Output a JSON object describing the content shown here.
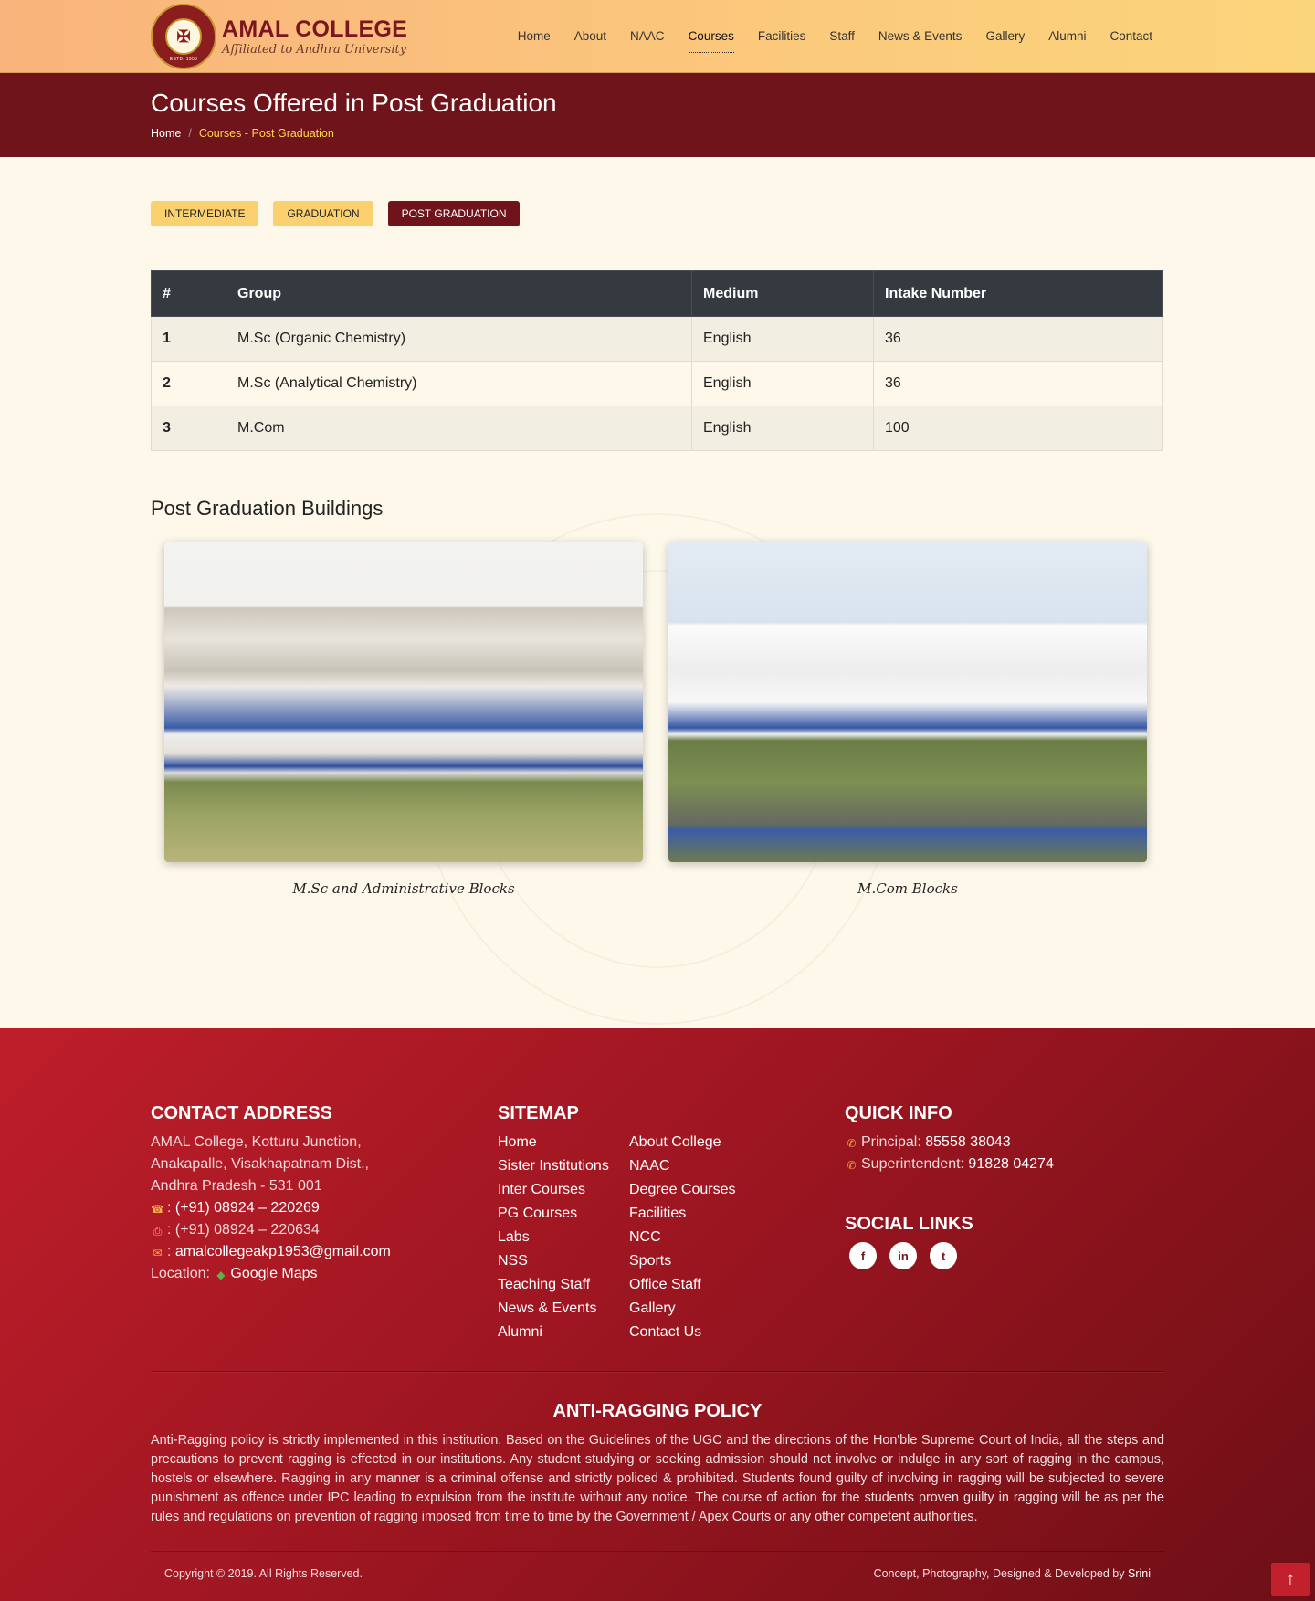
{
  "header": {
    "college_name": "AMAL COLLEGE",
    "affiliation": "Affiliated to Andhra University",
    "logo_estd": "ESTD. 1953",
    "nav": [
      {
        "label": "Home"
      },
      {
        "label": "About"
      },
      {
        "label": "NAAC"
      },
      {
        "label": "Courses",
        "active": true
      },
      {
        "label": "Facilities"
      },
      {
        "label": "Staff"
      },
      {
        "label": "News & Events"
      },
      {
        "label": "Gallery"
      },
      {
        "label": "Alumni"
      },
      {
        "label": "Contact"
      }
    ]
  },
  "title_bar": {
    "title": "Courses Offered in Post Graduation",
    "breadcrumb_home": "Home",
    "breadcrumb_separator": "/",
    "breadcrumb_current": "Courses - Post Graduation"
  },
  "tabs": [
    {
      "label": "INTERMEDIATE"
    },
    {
      "label": "GRADUATION"
    },
    {
      "label": "POST GRADUATION",
      "active": true
    }
  ],
  "courses_table": {
    "headers": [
      "#",
      "Group",
      "Medium",
      "Intake Number"
    ],
    "rows": [
      [
        "1",
        "M.Sc (Organic Chemistry)",
        "English",
        "36"
      ],
      [
        "2",
        "M.Sc (Analytical Chemistry)",
        "English",
        "36"
      ],
      [
        "3",
        "M.Com",
        "English",
        "100"
      ]
    ]
  },
  "buildings": {
    "title": "Post Graduation Buildings",
    "photos": [
      {
        "caption": "M.Sc and Administrative Blocks"
      },
      {
        "caption": "M.Com Blocks"
      }
    ]
  },
  "footer": {
    "contact": {
      "title": "CONTACT ADDRESS",
      "address_lines": [
        "AMAL College, Kotturu Junction,",
        "Anakapalle, Visakhapatnam Dist.,",
        "Andhra Pradesh - 531 001"
      ],
      "phone_label": ": ",
      "phone": "(+91) 08924 – 220269",
      "fax_label": ": ",
      "fax": "(+91) 08924 – 220634",
      "email_label": ": ",
      "email": "amalcollegeakp1953@gmail.com",
      "location_label": "Location: ",
      "location_link": "Google Maps"
    },
    "sitemap": {
      "title": "SITEMAP",
      "links": [
        "Home",
        "About College",
        "Sister Institutions",
        "NAAC",
        "Inter Courses",
        "Degree Courses",
        "PG Courses",
        "Facilities",
        "Labs",
        "NCC",
        "NSS",
        "Sports",
        "Teaching Staff",
        "Office Staff",
        "News & Events",
        "Gallery",
        "Alumni",
        "Contact Us"
      ]
    },
    "quick_info": {
      "title": "QUICK INFO",
      "principal_label": "Principal: ",
      "principal_phone": "85558 38043",
      "superintendent_label": "Superintendent: ",
      "superintendent_phone": "91828 04274"
    },
    "social": {
      "title": "SOCIAL LINKS",
      "links": [
        {
          "icon": "facebook-icon",
          "glyph": "f"
        },
        {
          "icon": "linkedin-icon",
          "glyph": "in"
        },
        {
          "icon": "twitter-icon",
          "glyph": "t"
        }
      ]
    },
    "ragging": {
      "title": "ANTI-RAGGING POLICY",
      "text": "Anti-Ragging policy is strictly implemented in this institution. Based on the Guidelines of the UGC and the directions of the Hon'ble Supreme Court of India, all the steps and precautions to prevent ragging is effected in our institutions. Any student studying or seeking admission should not involve or indulge in any sort of ragging in the campus, hostels or elsewhere. Ragging in any manner is a criminal offense and strictly policed & prohibited. Students found guilty of involving in ragging will be subjected to severe punishment as offence under IPC leading to expulsion from the institute without any notice. The course of action for the students proven guilty in ragging will be as per the rules and regulations on prevention of ragging imposed from time to time by the Government / Apex Courts or any other competent authorities."
    },
    "copyright": "Copyright © 2019. All Rights Reserved.",
    "credit_prefix": "Concept, Photography, Designed & Developed by ",
    "credit_author": "Srini",
    "to_top_glyph": "↑"
  }
}
